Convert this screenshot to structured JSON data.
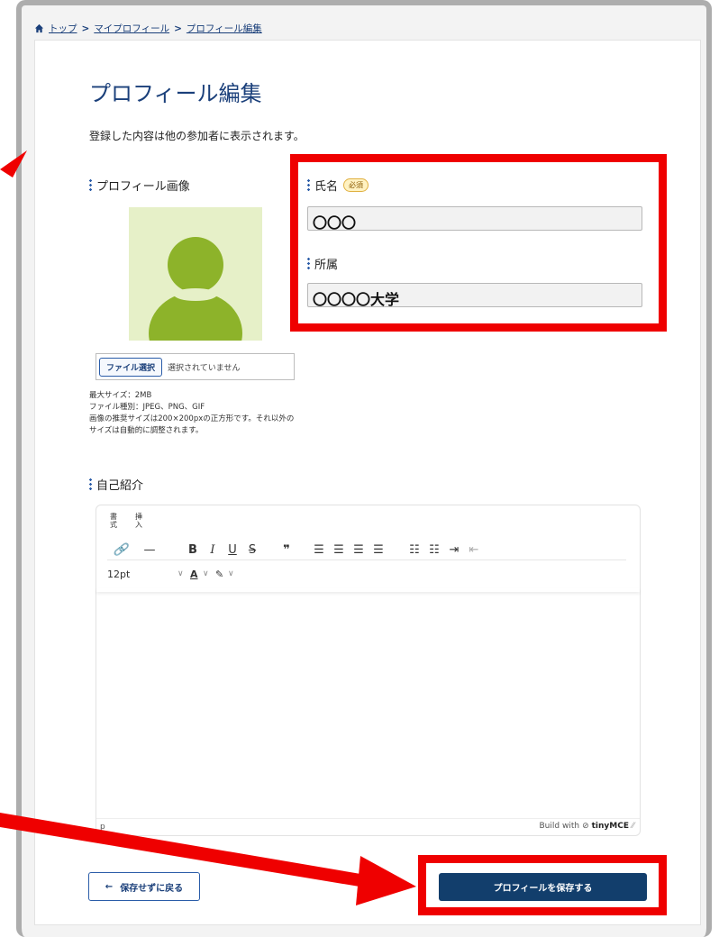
{
  "breadcrumb": {
    "items": [
      "トップ",
      "マイプロフィール",
      "プロフィール編集"
    ],
    "separator": ">"
  },
  "page": {
    "title": "プロフィール編集",
    "description": "登録した内容は他の参加者に表示されます。"
  },
  "profile_image": {
    "label": "プロフィール画像",
    "file_button": "ファイル選択",
    "file_status": "選択されていません",
    "notes": [
      "最大サイズ：2MB",
      "ファイル種別：JPEG、PNG、GIF",
      "画像の推奨サイズは200×200pxの正方形です。それ以外のサイズは自動的に調整されます。"
    ]
  },
  "name_field": {
    "label": "氏名",
    "required_badge": "必須",
    "value": "〇〇〇"
  },
  "affiliation_field": {
    "label": "所属",
    "value": "〇〇〇〇大学"
  },
  "bio": {
    "label": "自己紹介",
    "menu": [
      "書式",
      "挿入"
    ],
    "font_size": "12pt",
    "status_path": "p",
    "brand_prefix": "Build with",
    "brand_name": "tinyMCE"
  },
  "actions": {
    "back_label": "保存せずに戻る",
    "save_label": "プロフィールを保存する"
  },
  "colors": {
    "accent": "#1a3f7a",
    "primary_button": "#123e6c",
    "highlight": "#ef0000",
    "avatar_bg": "#e6f0c8",
    "avatar_fg": "#8db32a"
  }
}
